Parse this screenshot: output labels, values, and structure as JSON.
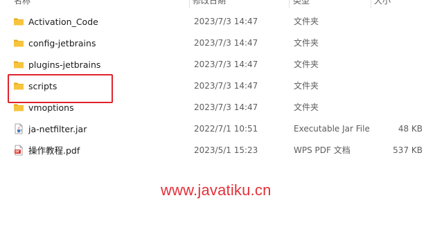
{
  "header": {
    "name_label": "名称",
    "date_label": "修改日期",
    "type_label": "类型",
    "size_label": "大小"
  },
  "files": [
    {
      "icon": "folder-icon",
      "name": "Activation_Code",
      "date": "2023/7/3 14:47",
      "type": "文件夹",
      "size": ""
    },
    {
      "icon": "folder-icon",
      "name": "config-jetbrains",
      "date": "2023/7/3 14:47",
      "type": "文件夹",
      "size": ""
    },
    {
      "icon": "folder-icon",
      "name": "plugins-jetbrains",
      "date": "2023/7/3 14:47",
      "type": "文件夹",
      "size": ""
    },
    {
      "icon": "folder-icon",
      "name": "scripts",
      "date": "2023/7/3 14:47",
      "type": "文件夹",
      "size": ""
    },
    {
      "icon": "folder-icon",
      "name": "vmoptions",
      "date": "2023/7/3 14:47",
      "type": "文件夹",
      "size": ""
    },
    {
      "icon": "jar-file-icon",
      "name": "ja-netfilter.jar",
      "date": "2022/7/1 10:51",
      "type": "Executable Jar File",
      "size": "48 KB"
    },
    {
      "icon": "pdf-file-icon",
      "name": "操作教程.pdf",
      "date": "2023/5/1 15:23",
      "type": "WPS PDF 文档",
      "size": "537 KB"
    }
  ],
  "watermark": "www.javatiku.cn",
  "colors": {
    "folder": "#f7c43d",
    "folder_dark": "#e6a817",
    "highlight": "#e0222a",
    "watermark": "#e4303a"
  }
}
